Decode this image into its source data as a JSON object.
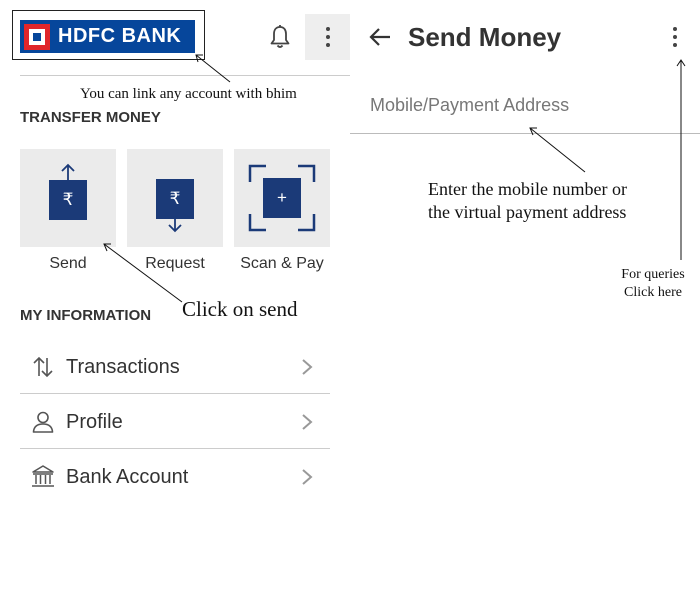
{
  "left_screen": {
    "logo": {
      "text": "HDFC BANK",
      "brand_color": "#06469b",
      "mark_color": "#e0262b"
    },
    "header_icons": [
      "bell-icon",
      "more-vert-icon"
    ],
    "transfer_money": {
      "heading": "TRANSFER MONEY",
      "tiles": [
        {
          "label": "Send",
          "icon": "rupee-up-arrow-icon",
          "glyph": "₹"
        },
        {
          "label": "Request",
          "icon": "rupee-down-arrow-icon",
          "glyph": "₹"
        },
        {
          "label": "Scan & Pay",
          "icon": "scan-plus-icon",
          "glyph": "+"
        }
      ],
      "tile_color": "#1b3a78"
    },
    "my_information": {
      "heading": "MY INFORMATION",
      "items": [
        {
          "label": "Transactions",
          "icon": "up-down-arrows-icon"
        },
        {
          "label": "Profile",
          "icon": "person-icon"
        },
        {
          "label": "Bank Account",
          "icon": "bank-icon"
        }
      ]
    }
  },
  "right_screen": {
    "title": "Send Money",
    "back_icon": "back-arrow-icon",
    "menu_icon": "more-vert-icon",
    "input": {
      "placeholder": "Mobile/Payment Address",
      "value": ""
    }
  },
  "annotations": {
    "link_note": "You can link any account with bhim",
    "send_note": "Click on send",
    "mobile_note_line1": "Enter the mobile number or",
    "mobile_note_line2": "the virtual payment address",
    "queries_line1": "For queries",
    "queries_line2": "Click here"
  }
}
